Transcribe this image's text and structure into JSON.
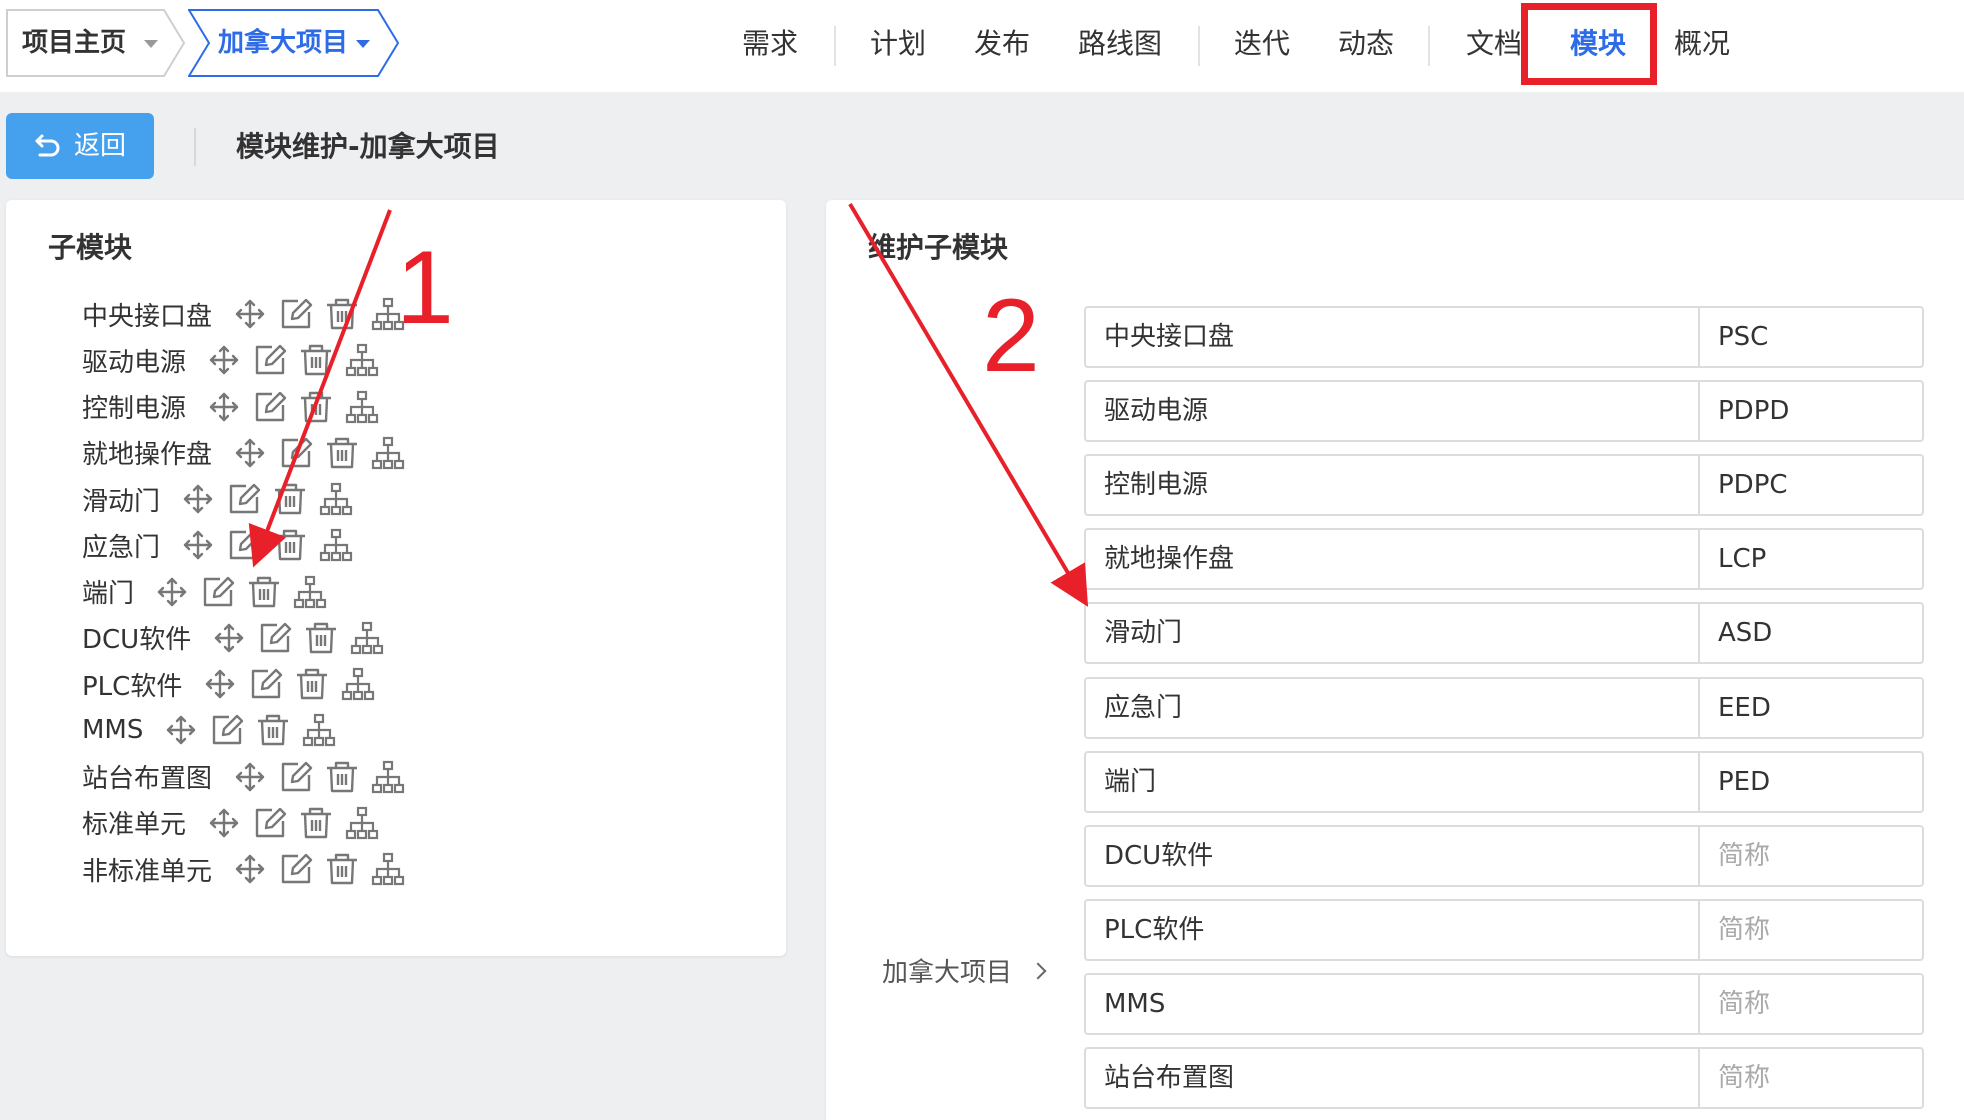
{
  "breadcrumb": [
    {
      "label": "项目主页"
    },
    {
      "label": "加拿大项目"
    }
  ],
  "nav": {
    "items": [
      "需求",
      "计划",
      "发布",
      "路线图",
      "迭代",
      "动态",
      "文档",
      "模块",
      "概况"
    ],
    "active": "模块"
  },
  "toolbar": {
    "back_label": "返回",
    "title": "模块维护-加拿大项目"
  },
  "left_panel": {
    "title": "子模块",
    "items": [
      "中央接口盘",
      "驱动电源",
      "控制电源",
      "就地操作盘",
      "滑动门",
      "应急门",
      "端门",
      "DCU软件",
      "PLC软件",
      "MMS",
      "站台布置图",
      "标准单元",
      "非标准单元"
    ],
    "row_icons": [
      "move-icon",
      "edit-icon",
      "trash-icon",
      "hierarchy-icon"
    ]
  },
  "right_panel": {
    "title": "维护子模块",
    "project_link": "加拿大项目",
    "abbr_placeholder": "简称",
    "modules": [
      {
        "name": "中央接口盘",
        "abbr": "PSC"
      },
      {
        "name": "驱动电源",
        "abbr": "PDPD"
      },
      {
        "name": "控制电源",
        "abbr": "PDPC"
      },
      {
        "name": "就地操作盘",
        "abbr": "LCP"
      },
      {
        "name": "滑动门",
        "abbr": "ASD"
      },
      {
        "name": "应急门",
        "abbr": "EED"
      },
      {
        "name": "端门",
        "abbr": "PED"
      },
      {
        "name": "DCU软件",
        "abbr": ""
      },
      {
        "name": "PLC软件",
        "abbr": ""
      },
      {
        "name": "MMS",
        "abbr": ""
      },
      {
        "name": "站台布置图",
        "abbr": ""
      }
    ]
  },
  "annotations": {
    "label_1": "1",
    "label_2": "2",
    "color": "#e8202a"
  },
  "colors": {
    "accent": "#2e6be6",
    "button": "#45a0ee",
    "annotation": "#e8202a"
  }
}
